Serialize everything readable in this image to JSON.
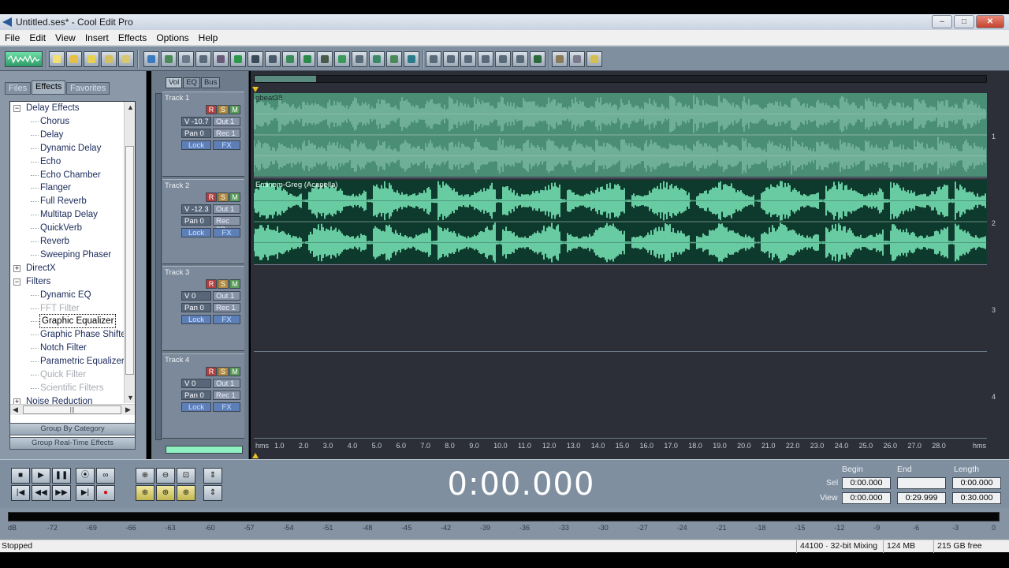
{
  "window": {
    "title": "Untitled.ses* - Cool Edit Pro",
    "buttons": {
      "minimize": "–",
      "maximize": "□",
      "close": "✕"
    }
  },
  "menu": [
    "File",
    "Edit",
    "View",
    "Insert",
    "Effects",
    "Options",
    "Help"
  ],
  "panel": {
    "tabs": [
      "Files",
      "Effects",
      "Favorites"
    ],
    "active_tab": "Effects",
    "tree": [
      {
        "label": "Delay Effects",
        "level": 0,
        "expander": "−"
      },
      {
        "label": "Chorus",
        "level": 1
      },
      {
        "label": "Delay",
        "level": 1
      },
      {
        "label": "Dynamic Delay",
        "level": 1
      },
      {
        "label": "Echo",
        "level": 1
      },
      {
        "label": "Echo Chamber",
        "level": 1
      },
      {
        "label": "Flanger",
        "level": 1
      },
      {
        "label": "Full Reverb",
        "level": 1
      },
      {
        "label": "Multitap Delay",
        "level": 1
      },
      {
        "label": "QuickVerb",
        "level": 1
      },
      {
        "label": "Reverb",
        "level": 1
      },
      {
        "label": "Sweeping Phaser",
        "level": 1
      },
      {
        "label": "DirectX",
        "level": 0,
        "expander": "+"
      },
      {
        "label": "Filters",
        "level": 0,
        "expander": "−"
      },
      {
        "label": "Dynamic EQ",
        "level": 1
      },
      {
        "label": "FFT Filter",
        "level": 1,
        "dim": true
      },
      {
        "label": "Graphic Equalizer",
        "level": 1,
        "selected": true
      },
      {
        "label": "Graphic Phase Shifter",
        "level": 1
      },
      {
        "label": "Notch Filter",
        "level": 1
      },
      {
        "label": "Parametric Equalizer",
        "level": 1
      },
      {
        "label": "Quick Filter",
        "level": 1,
        "dim": true
      },
      {
        "label": "Scientific Filters",
        "level": 1,
        "dim": true
      },
      {
        "label": "Noise Reduction",
        "level": 0,
        "expander": "+"
      }
    ],
    "group_by_category": "Group By Category",
    "group_realtime": "Group Real-Time Effects"
  },
  "mixer_tabs": [
    "Vol",
    "EQ",
    "Bus"
  ],
  "tracks": [
    {
      "name": "Track 1",
      "r": "R",
      "s": "S",
      "m": "M",
      "vol": "V -10.7",
      "out": "Out 1",
      "pan": "Pan 0",
      "rec": "Rec 1",
      "lock": "Lock",
      "fx": "FX",
      "clip": "gbeat38",
      "num": "1"
    },
    {
      "name": "Track 2",
      "r": "R",
      "s": "S",
      "m": "M",
      "vol": "V -12.3",
      "out": "Out 1",
      "pan": "Pan 0",
      "rec": "Rec 2R",
      "lock": "Lock",
      "fx": "FX",
      "clip": "Eminem-Greg (Acapella)",
      "num": "2"
    },
    {
      "name": "Track 3",
      "r": "R",
      "s": "S",
      "m": "M",
      "vol": "V 0",
      "out": "Out 1",
      "pan": "Pan 0",
      "rec": "Rec 1",
      "lock": "Lock",
      "fx": "FX",
      "clip": "",
      "num": "3"
    },
    {
      "name": "Track 4",
      "r": "R",
      "s": "S",
      "m": "M",
      "vol": "V 0",
      "out": "Out 1",
      "pan": "Pan 0",
      "rec": "Rec 1",
      "lock": "Lock",
      "fx": "FX",
      "clip": "",
      "num": "4"
    }
  ],
  "ruler": {
    "unit_left": "hms",
    "unit_right": "hms",
    "ticks": [
      "1.0",
      "2.0",
      "3.0",
      "4.0",
      "5.0",
      "6.0",
      "7.0",
      "8.0",
      "9.0",
      "10.0",
      "11.0",
      "12.0",
      "13.0",
      "14.0",
      "15.0",
      "16.0",
      "17.0",
      "18.0",
      "19.0",
      "20.0",
      "21.0",
      "22.0",
      "23.0",
      "24.0",
      "25.0",
      "26.0",
      "27.0",
      "28.0"
    ]
  },
  "transport": {
    "time": "0:00.000",
    "labels": {
      "begin": "Begin",
      "end": "End",
      "length": "Length",
      "sel": "Sel",
      "view": "View"
    },
    "sel": {
      "begin": "0:00.000",
      "end": "",
      "length": "0:00.000"
    },
    "view": {
      "begin": "0:00.000",
      "end": "0:29.999",
      "length": "0:30.000"
    }
  },
  "level_meter": {
    "ticks": [
      "dB",
      "-72",
      "-69",
      "-66",
      "-63",
      "-60",
      "-57",
      "-54",
      "-51",
      "-48",
      "-45",
      "-42",
      "-39",
      "-36",
      "-33",
      "-30",
      "-27",
      "-24",
      "-21",
      "-18",
      "-15",
      "-12",
      "-9",
      "-6",
      "-3",
      "0"
    ]
  },
  "status": {
    "state": "Stopped",
    "format": "44100 · 32-bit Mixing",
    "memory": "124 MB",
    "disk": "215 GB free"
  },
  "colors": {
    "track1_wave": "#4a8e76",
    "track2_wave": "#7ff0c0",
    "track_bg": "#2c2f38"
  }
}
